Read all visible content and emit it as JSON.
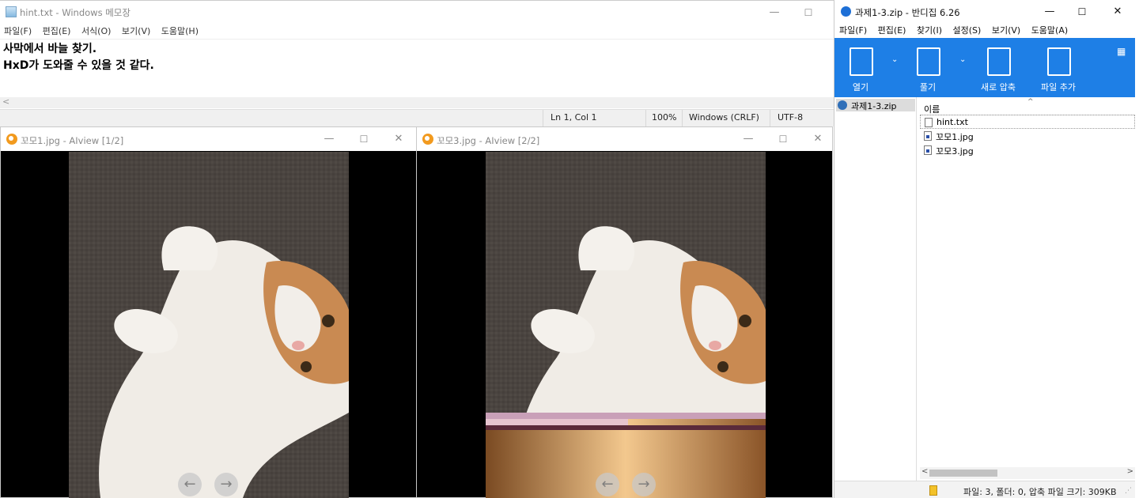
{
  "notepad": {
    "title": "hint.txt - Windows 메모장",
    "menu": [
      "파일(F)",
      "편집(E)",
      "서식(O)",
      "보기(V)",
      "도움말(H)"
    ],
    "lines": [
      "사막에서 바늘 찾기.",
      "HxD가 도와줄 수 있을 것 같다."
    ],
    "status": {
      "position": "Ln 1, Col 1",
      "zoom": "100%",
      "line_ending": "Windows (CRLF)",
      "encoding": "UTF-8"
    },
    "window_buttons": {
      "minimize": "—",
      "maximize": "☐"
    }
  },
  "aiview_left": {
    "title": "꼬모1.jpg - AIview [1/2]",
    "window_buttons": {
      "minimize": "—",
      "maximize": "☐",
      "close": "✕"
    },
    "nav": {
      "prev": "←",
      "next": "→"
    }
  },
  "aiview_right": {
    "title": "꼬모3.jpg - AIview [2/2]",
    "window_buttons": {
      "minimize": "—",
      "maximize": "☐",
      "close": "✕"
    },
    "nav": {
      "prev": "←",
      "next": "→"
    }
  },
  "bandizip": {
    "title": "과제1-3.zip - 반디집 6.26",
    "window_buttons": {
      "minimize": "—",
      "maximize": "☐",
      "close": "✕"
    },
    "menu": [
      "파일(F)",
      "편집(E)",
      "찾기(I)",
      "설정(S)",
      "보기(V)",
      "도움말(A)"
    ],
    "toolbar": {
      "open": "열기",
      "extract": "풀기",
      "new_archive": "새로 압축",
      "add_file": "파일 추가"
    },
    "tree_item": "과제1-3.zip",
    "column_name": "이름",
    "files": [
      {
        "name": "hint.txt",
        "icon": "text-file-icon"
      },
      {
        "name": "꼬모1.jpg",
        "icon": "image-file-icon"
      },
      {
        "name": "꼬모3.jpg",
        "icon": "image-file-icon"
      }
    ],
    "status": "파일: 3, 폴더: 0, 압축 파일 크기: 309KB",
    "accent_color": "#1e7fe6"
  }
}
